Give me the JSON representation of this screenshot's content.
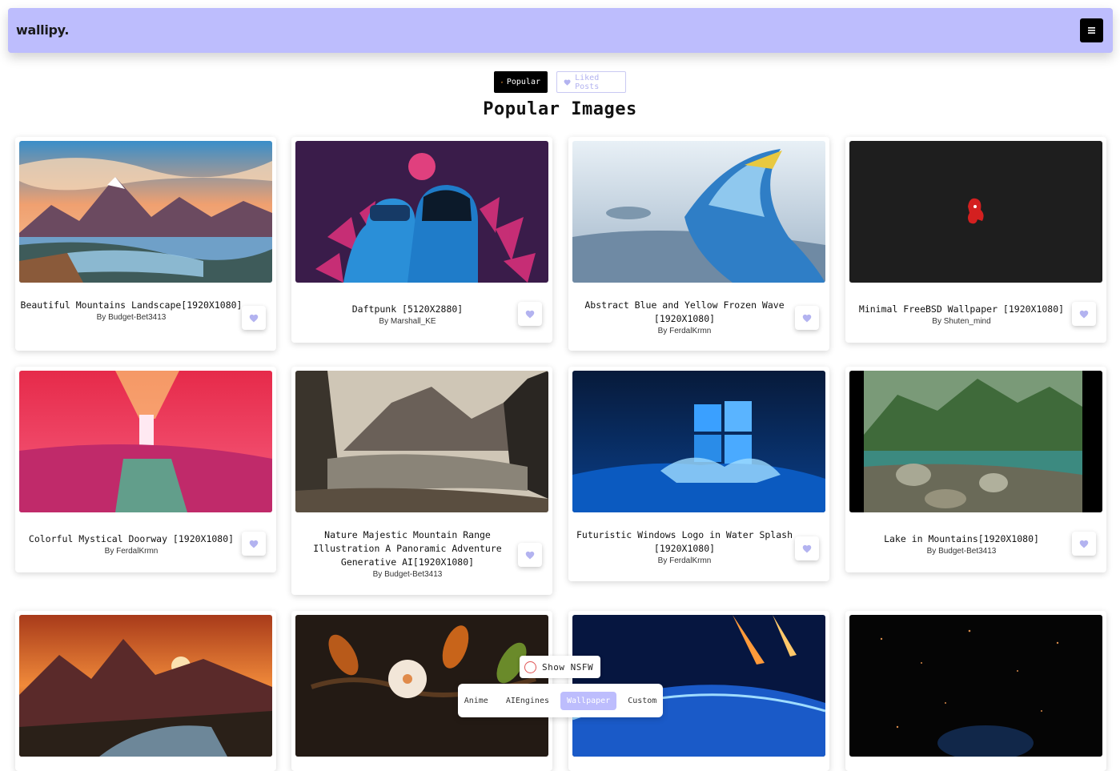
{
  "brand": "wallipy.",
  "tabs": {
    "popular_label": "Popular",
    "liked_label": "Liked Posts"
  },
  "page_title": "Popular Images",
  "cards": [
    {
      "title": "Beautiful Mountains Landscape[1920X1080]",
      "author": "By Budget-Bet3413"
    },
    {
      "title": "Daftpunk [5120X2880]",
      "author": "By Marshall_KE"
    },
    {
      "title": "Abstract Blue and Yellow Frozen Wave [1920X1080]",
      "author": "By FerdalKrmn"
    },
    {
      "title": "Minimal FreeBSD Wallpaper [1920X1080]",
      "author": "By Shuten_mind"
    },
    {
      "title": "Colorful Mystical Doorway [1920X1080]",
      "author": "By FerdalKrmn"
    },
    {
      "title": "Nature Majestic Mountain Range Illustration A Panoramic Adventure Generative AI[1920X1080]",
      "author": "By Budget-Bet3413"
    },
    {
      "title": "Futuristic Windows Logo in Water Splash [1920X1080]",
      "author": "By FerdalKrmn"
    },
    {
      "title": "Lake in Mountains[1920X1080]",
      "author": "By Budget-Bet3413"
    },
    {
      "title": "",
      "author": ""
    },
    {
      "title": "",
      "author": ""
    },
    {
      "title": "",
      "author": ""
    },
    {
      "title": "",
      "author": ""
    }
  ],
  "nsfw_label": "Show NSFW",
  "categories": [
    "Anime",
    "AIEngines",
    "Wallpaper",
    "Custom"
  ],
  "active_category": "Wallpaper",
  "colors": {
    "nav": "#bdbdfd",
    "accent": "#bdbdfd",
    "heart": "#b3b3f0"
  }
}
